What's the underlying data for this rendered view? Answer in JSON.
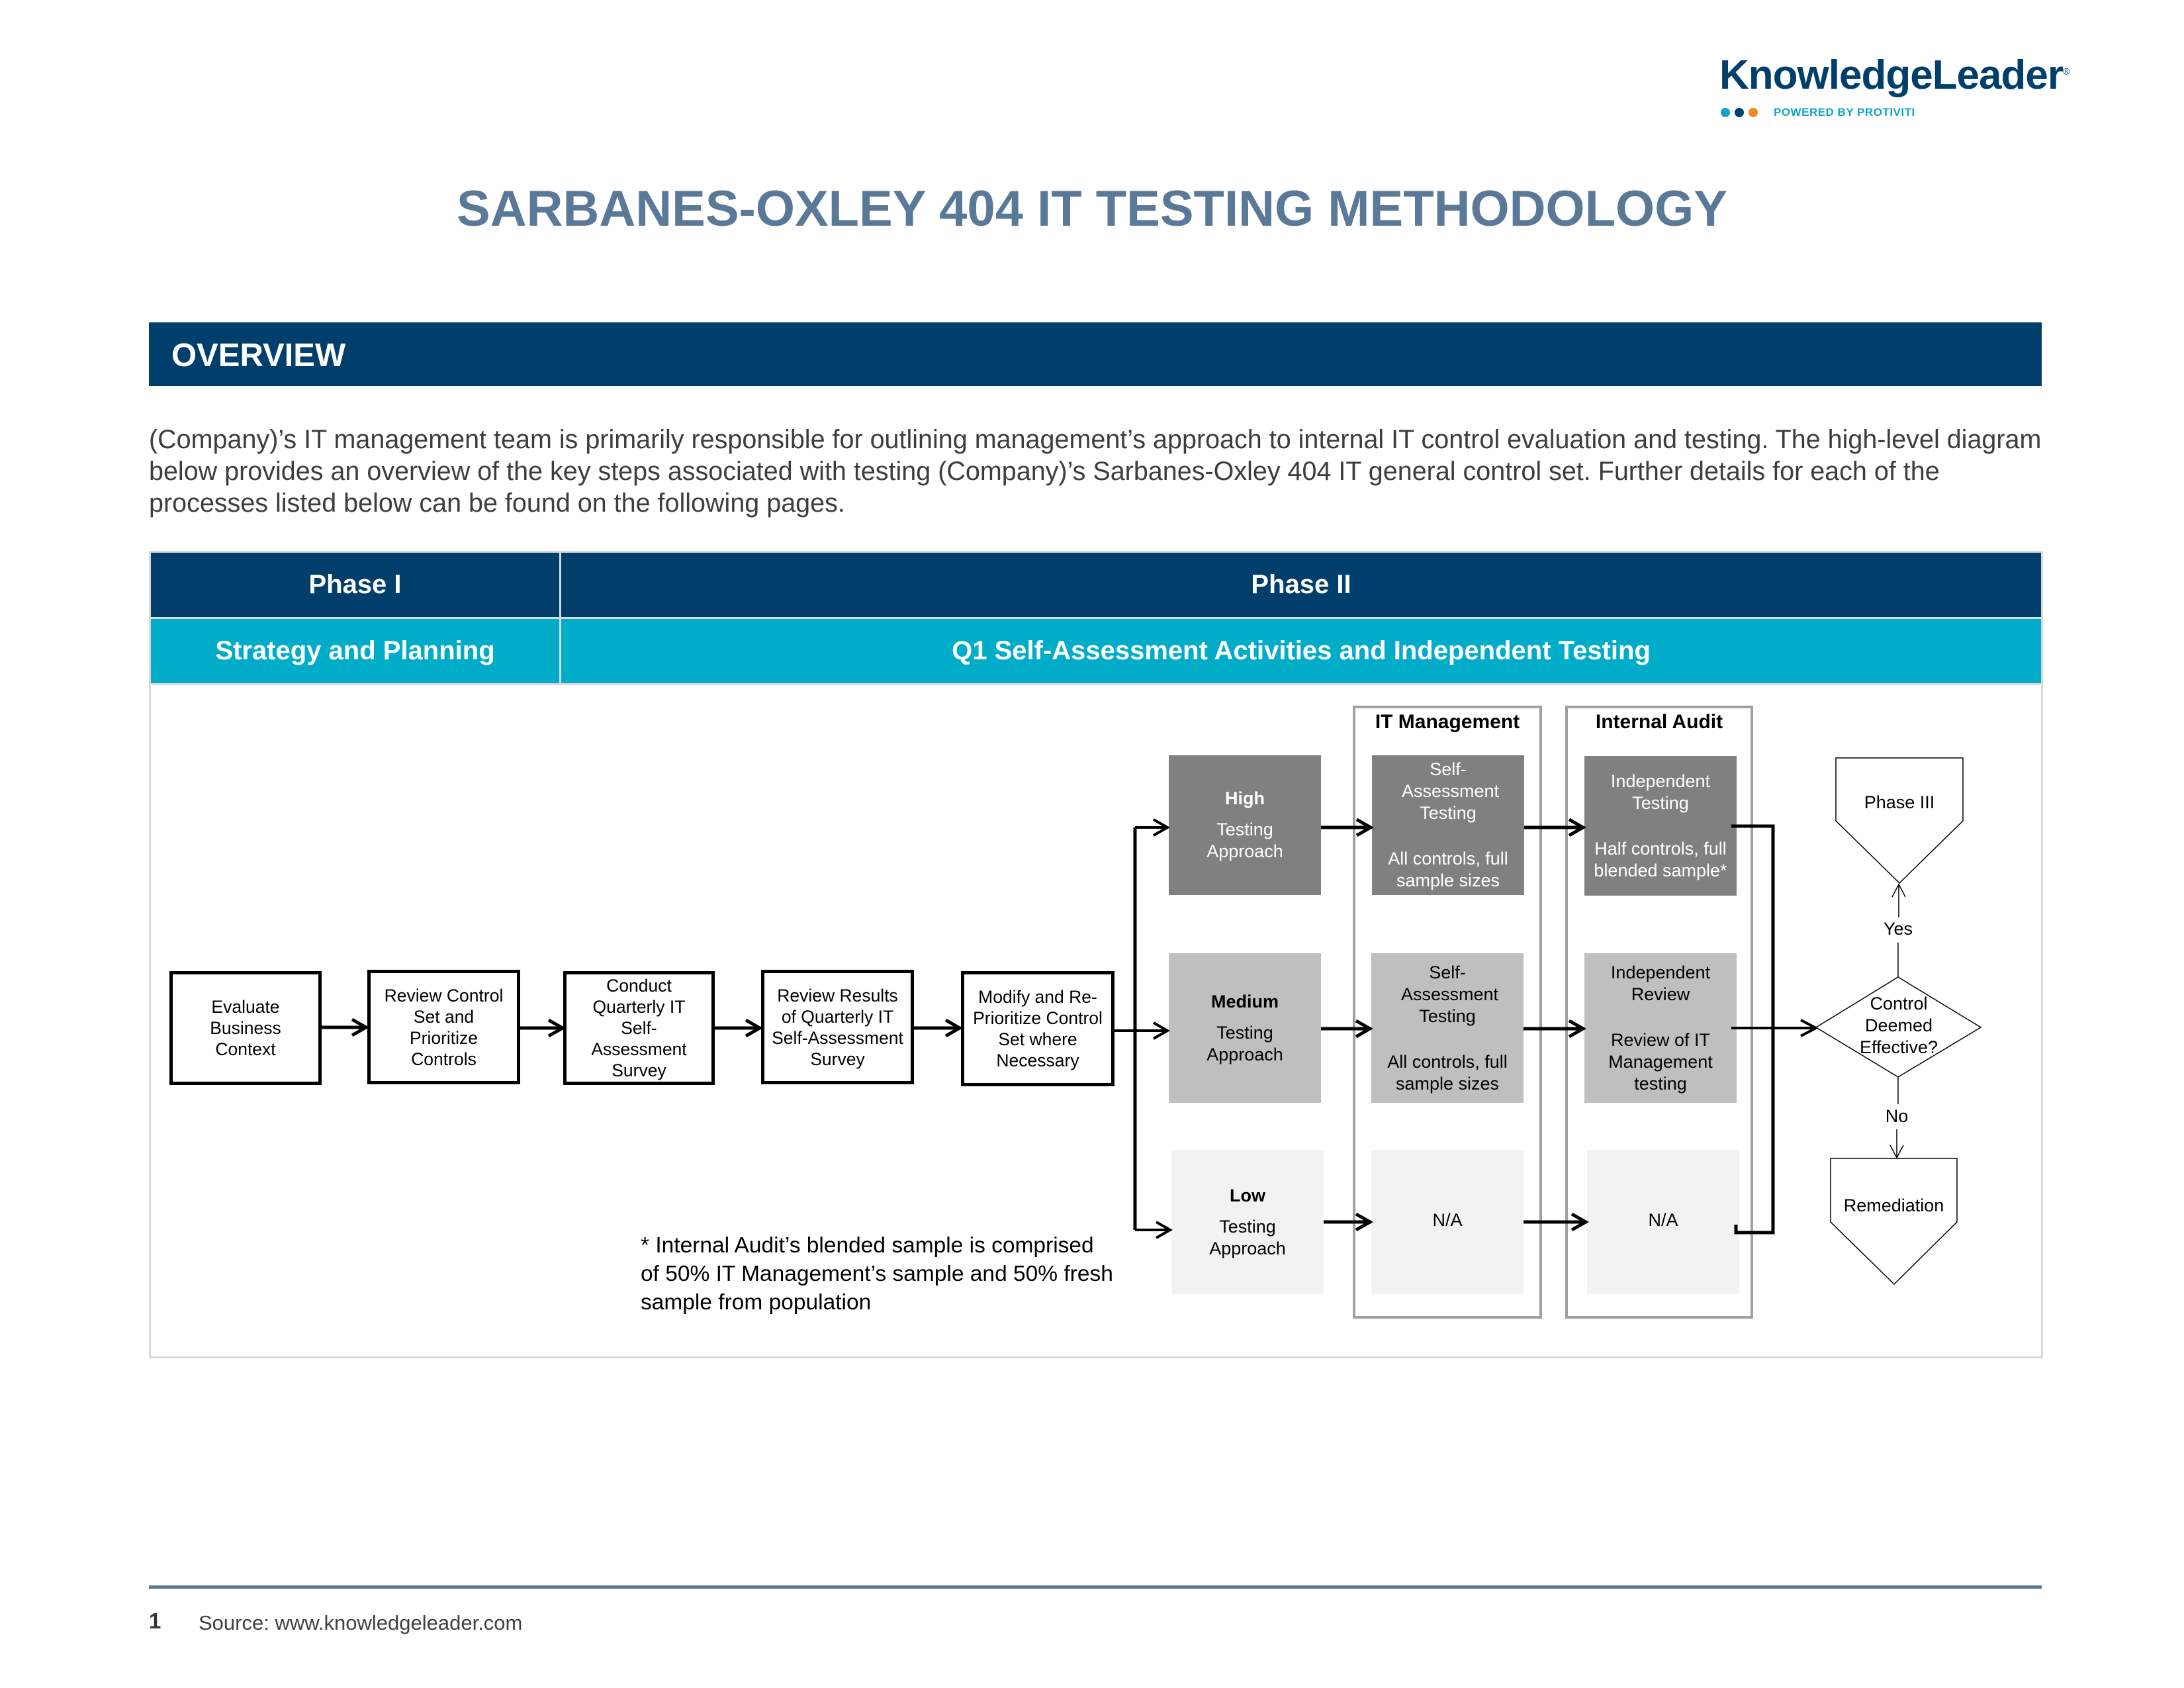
{
  "logo": {
    "name": "KnowledgeLeader",
    "registered": "®",
    "tagline": "POWERED BY PROTIVITI",
    "dot_colors": [
      "#10a5c5",
      "#003f6b",
      "#f28a1e"
    ]
  },
  "title": "SARBANES-OXLEY 404 IT TESTING METHODOLOGY",
  "overview": {
    "heading": "OVERVIEW",
    "paragraph": "(Company)’s IT management team is primarily responsible for outlining management’s approach to internal IT control evaluation and testing. The high-level diagram below provides an overview of the key steps associated with testing (Company)’s Sarbanes-Oxley 404 IT general control set. Further details for each of the processes listed below can be found on the following pages."
  },
  "table": {
    "phases": [
      {
        "label": "Phase I",
        "subtitle": "Strategy and Planning"
      },
      {
        "label": "Phase II",
        "subtitle": "Q1 Self-Assessment Activities and Independent Testing"
      }
    ]
  },
  "diagram": {
    "process_steps": [
      "Evaluate Business Context",
      "Review Control Set and Prioritize Controls",
      "Conduct Quarterly IT Self-Assessment Survey",
      "Review Results of Quarterly IT Self-Assessment Survey",
      "Modify and Re-Prioritize Control Set where Necessary"
    ],
    "containers": {
      "it_management": "IT Management",
      "internal_audit": "Internal Audit"
    },
    "tiers": [
      {
        "level": "High",
        "approach": "Testing Approach",
        "it_mgmt": {
          "title": "Self-Assessment Testing",
          "detail": "All controls, full sample sizes"
        },
        "internal_audit": {
          "title": "Independent Testing",
          "detail": "Half controls, full blended sample*"
        }
      },
      {
        "level": "Medium",
        "approach": "Testing Approach",
        "it_mgmt": {
          "title": "Self-Assessment Testing",
          "detail": "All controls, full sample sizes"
        },
        "internal_audit": {
          "title": "Independent Review",
          "detail": "Review of IT Management testing"
        }
      },
      {
        "level": "Low",
        "approach": "Testing Approach",
        "it_mgmt": {
          "title": "N/A",
          "detail": ""
        },
        "internal_audit": {
          "title": "N/A",
          "detail": ""
        }
      }
    ],
    "decision": "Control Deemed Effective?",
    "yes_label": "Yes",
    "no_label": "No",
    "yes_outcome": "Phase III",
    "no_outcome": "Remediation",
    "footnote": "* Internal Audit’s blended sample is comprised of 50% IT Management’s sample and 50% fresh sample from population"
  },
  "footer": {
    "page_number": "1",
    "source": "Source: www.knowledgeleader.com"
  },
  "colors": {
    "navy": "#003f6b",
    "teal": "#00acc8",
    "title_blue": "#5a7898",
    "high_gray": "#808080",
    "medium_gray": "#bfbfbf",
    "low_gray": "#f2f2f2"
  }
}
